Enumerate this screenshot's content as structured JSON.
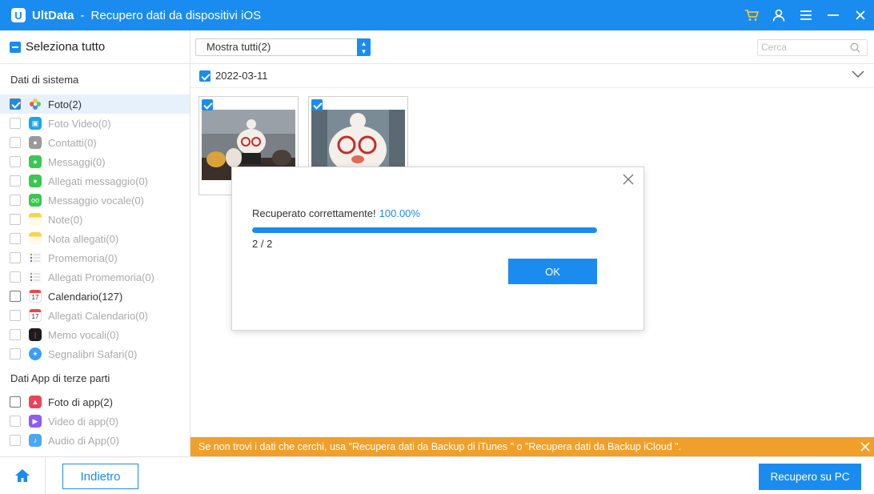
{
  "titlebar": {
    "logo_letter": "U",
    "app_name": "UltData",
    "separator": "-",
    "subtitle": "Recupero dati da dispositivi iOS",
    "icons": [
      "cart-icon",
      "user-icon",
      "menu-icon",
      "minimize-icon",
      "close-icon"
    ]
  },
  "sidebar": {
    "select_all": "Seleziona tutto",
    "system_title": "Dati di sistema",
    "system_items": [
      {
        "label": "Foto(2)",
        "checked": true,
        "icon": "photos-icon"
      },
      {
        "label": "Foto Video(0)",
        "checked": false,
        "icon": "photo-video-icon"
      },
      {
        "label": "Contatti(0)",
        "checked": false,
        "icon": "contacts-icon"
      },
      {
        "label": "Messaggi(0)",
        "checked": false,
        "icon": "messages-icon"
      },
      {
        "label": "Allegati messaggio(0)",
        "checked": false,
        "icon": "message-attachments-icon"
      },
      {
        "label": "Messaggio vocale(0)",
        "checked": false,
        "icon": "voicemail-icon"
      },
      {
        "label": "Note(0)",
        "checked": false,
        "icon": "notes-icon"
      },
      {
        "label": "Nota allegati(0)",
        "checked": false,
        "icon": "notes-attachments-icon"
      },
      {
        "label": "Promemoria(0)",
        "checked": false,
        "icon": "reminders-icon"
      },
      {
        "label": "Allegati Promemoria(0)",
        "checked": false,
        "icon": "reminders-attachments-icon"
      },
      {
        "label": "Calendario(127)",
        "checked": false,
        "icon": "calendar-icon"
      },
      {
        "label": "Allegati Calendario(0)",
        "checked": false,
        "icon": "calendar-attachments-icon"
      },
      {
        "label": "Memo vocali(0)",
        "checked": false,
        "icon": "voice-memos-icon"
      },
      {
        "label": "Segnalibri Safari(0)",
        "checked": false,
        "icon": "safari-icon"
      }
    ],
    "third_party_title": "Dati App di terze parti",
    "third_party_items": [
      {
        "label": "Foto di app(2)",
        "checked": false,
        "icon": "app-photos-icon"
      },
      {
        "label": "Video di app(0)",
        "checked": false,
        "icon": "app-video-icon"
      },
      {
        "label": "Audio di App(0)",
        "checked": false,
        "icon": "app-audio-icon"
      }
    ]
  },
  "main": {
    "filter_value": "Mostra tutti(2)",
    "search_placeholder": "Cerca",
    "group_date": "2022-03-11"
  },
  "banner": {
    "text": "Se non trovi i dati che cerchi, usa \"Recupera dati da Backup di iTunes \" o \"Recupera dati da Backup iCloud \"."
  },
  "footer": {
    "back_label": "Indietro",
    "recover_label": "Recupero su PC"
  },
  "dialog": {
    "message": "Recuperato correttamente!",
    "percent": "100.00%",
    "progress_fraction": 1.0,
    "count": "2 / 2",
    "ok_label": "OK"
  },
  "colors": {
    "accent": "#1a8cf0",
    "banner": "#f0a02a"
  }
}
